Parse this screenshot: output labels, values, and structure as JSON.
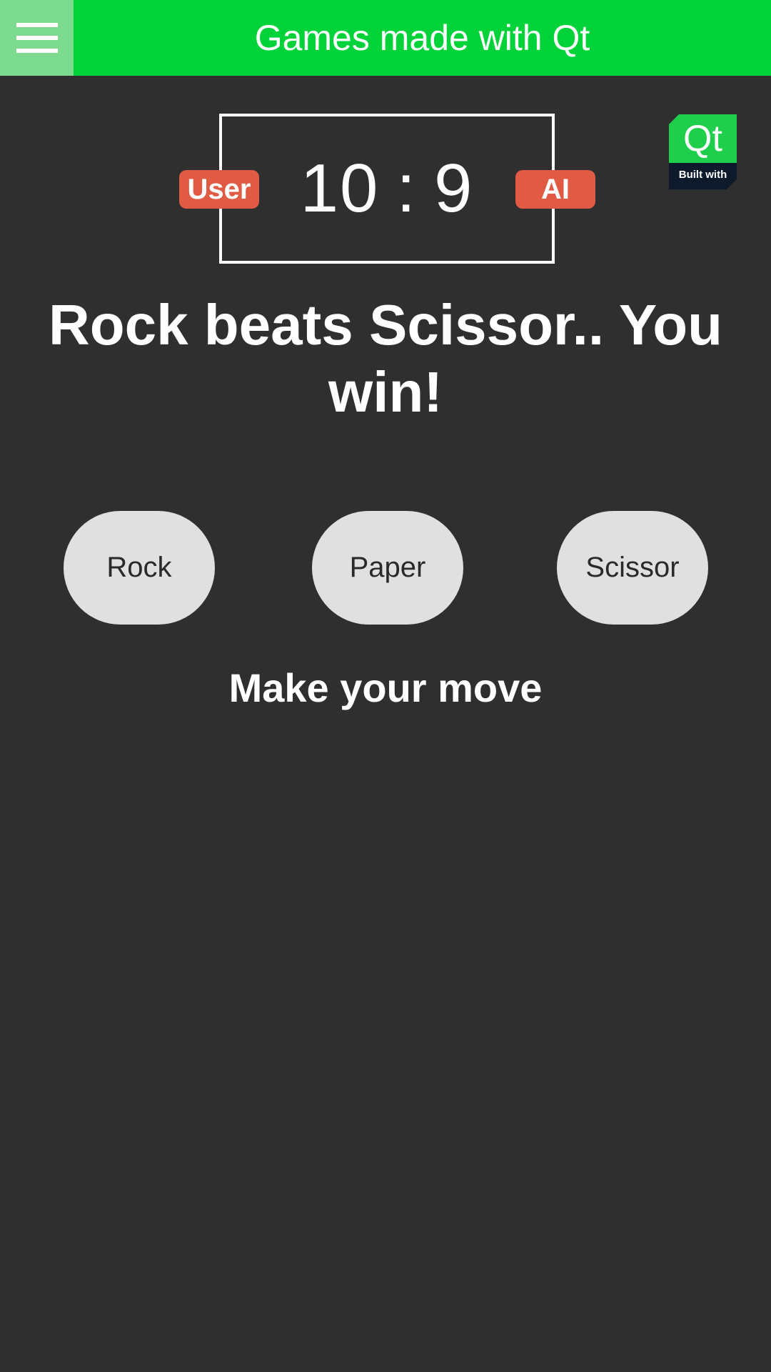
{
  "header": {
    "title": "Games made with Qt",
    "menu_icon": "hamburger-menu-icon",
    "background_color": "#00d23a"
  },
  "scoreboard": {
    "user_label": "User",
    "ai_label": "AI",
    "user_score": "10",
    "separator": ":",
    "ai_score": "9",
    "badge_color": "#e05a44"
  },
  "qt_logo": {
    "brand": "Qt",
    "caption": "Built with"
  },
  "result": {
    "message": "Rock beats Scissor.. You win!"
  },
  "moves": {
    "rock": "Rock",
    "paper": "Paper",
    "scissor": "Scissor"
  },
  "prompt": {
    "text": "Make your move"
  }
}
